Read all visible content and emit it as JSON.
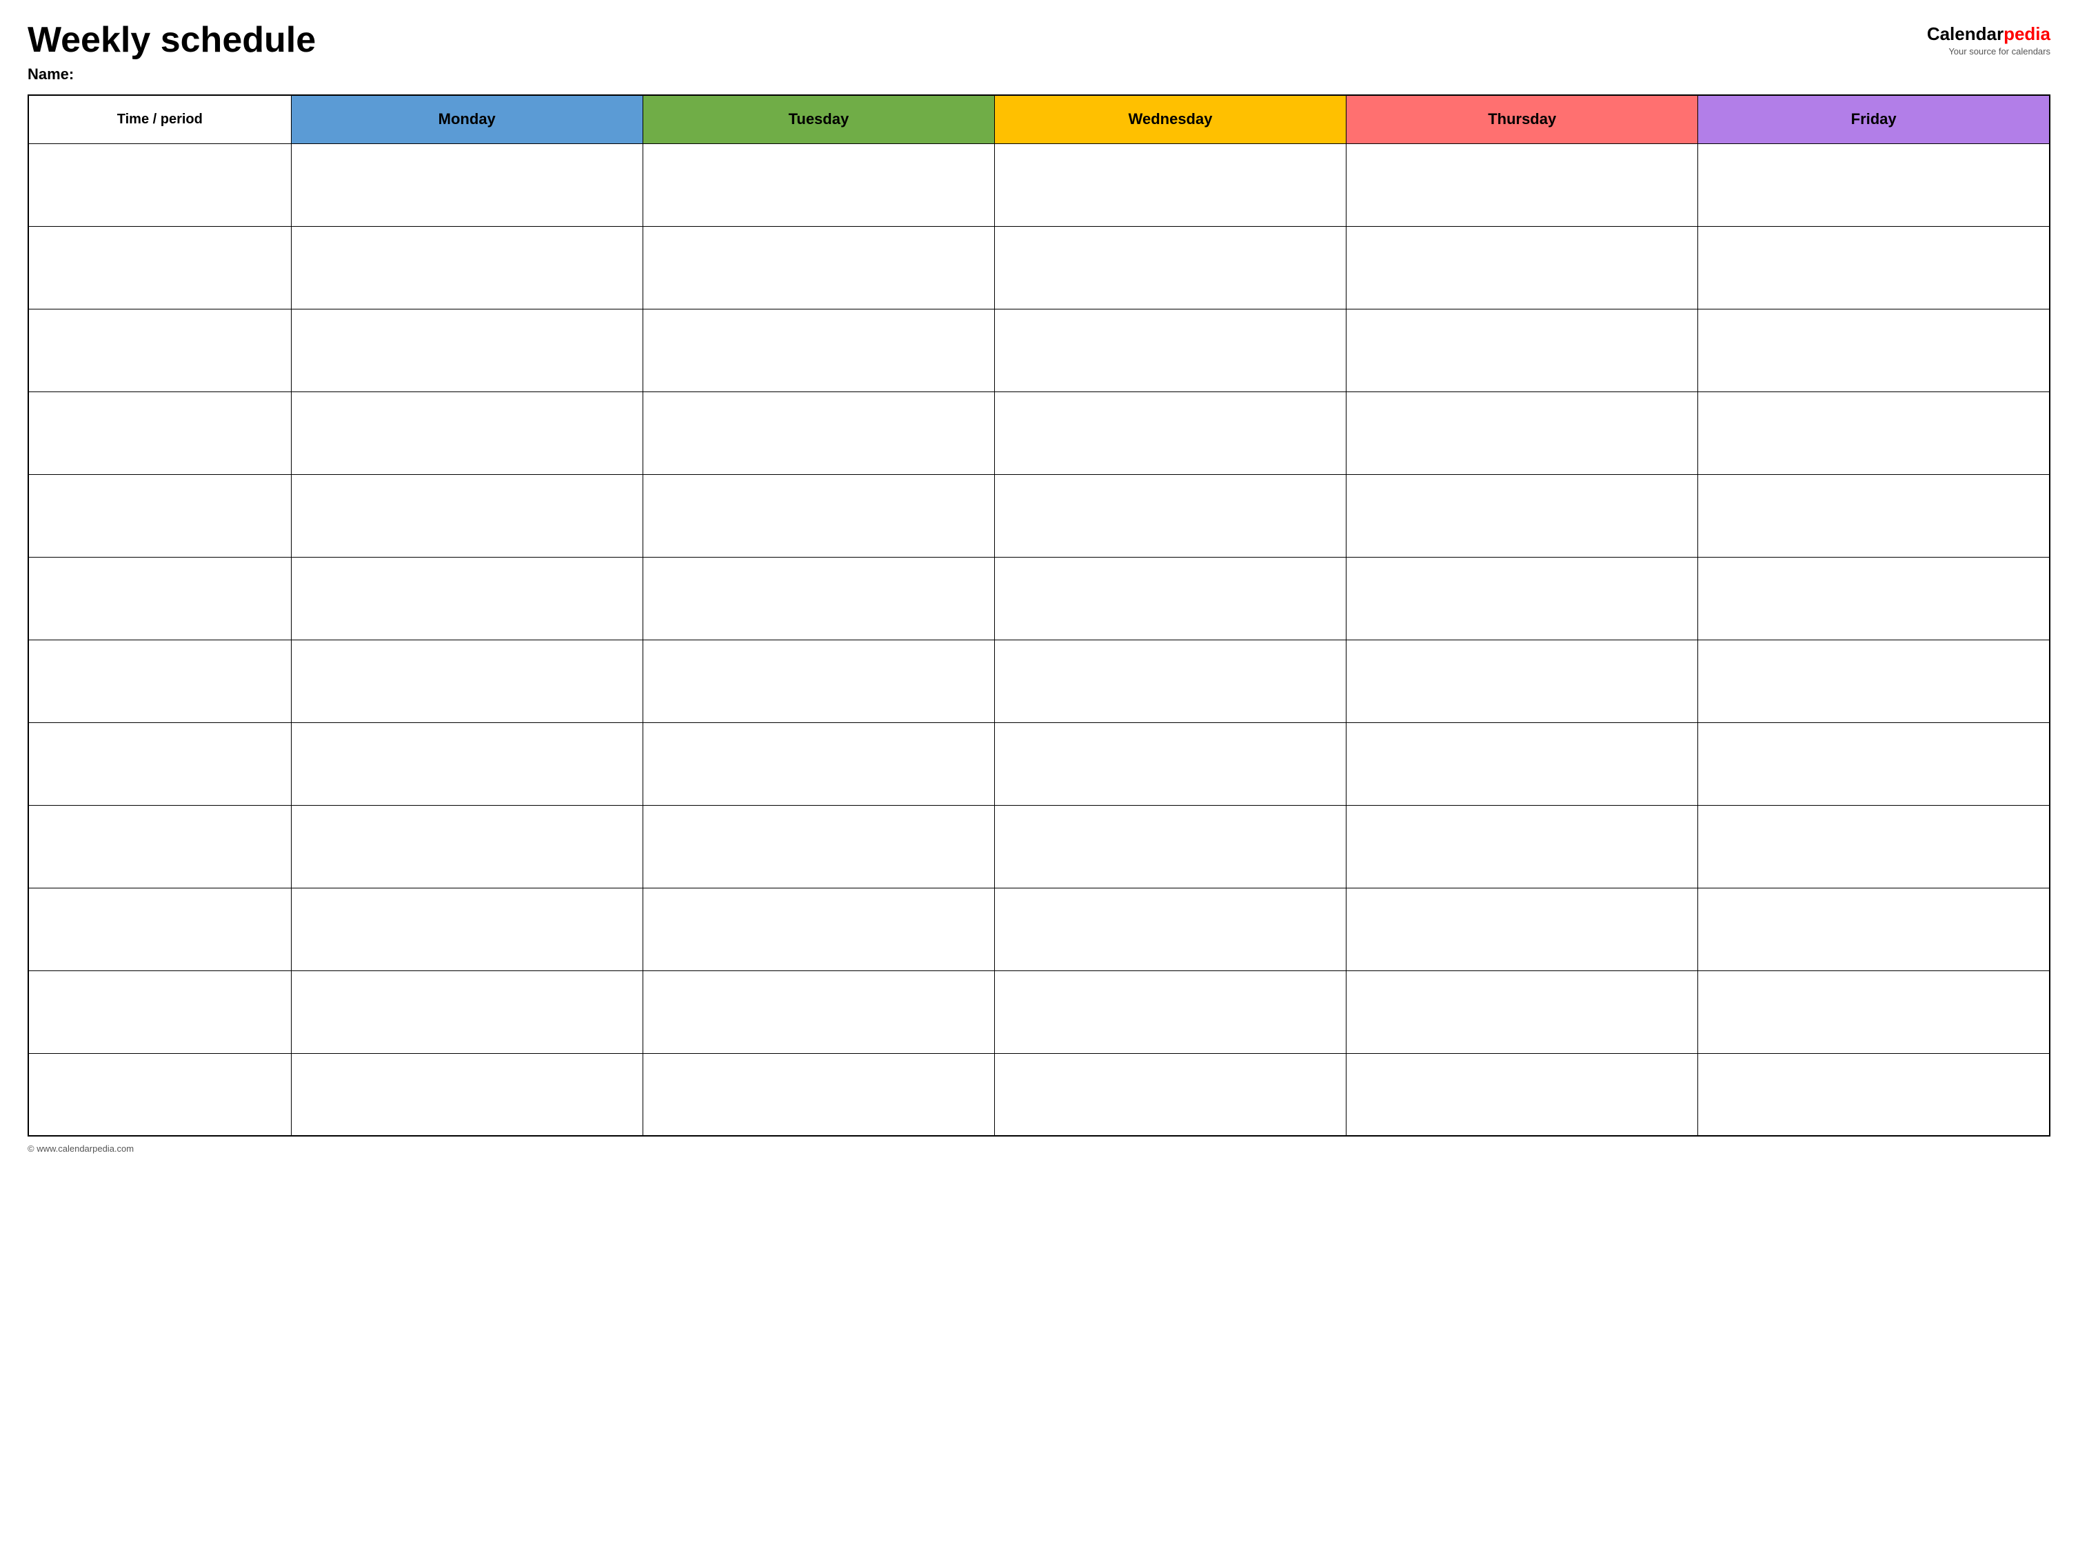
{
  "header": {
    "title": "Weekly schedule",
    "name_label": "Name:",
    "logo": {
      "calendar_part": "Calendar",
      "pedia_part": "pedia",
      "tagline": "Your source for calendars"
    }
  },
  "table": {
    "columns": [
      {
        "id": "time",
        "label": "Time / period",
        "color": "#ffffff",
        "class": "time-header"
      },
      {
        "id": "monday",
        "label": "Monday",
        "color": "#5b9bd5",
        "class": "monday-header"
      },
      {
        "id": "tuesday",
        "label": "Tuesday",
        "color": "#70ad47",
        "class": "tuesday-header"
      },
      {
        "id": "wednesday",
        "label": "Wednesday",
        "color": "#ffc000",
        "class": "wednesday-header"
      },
      {
        "id": "thursday",
        "label": "Thursday",
        "color": "#ff7070",
        "class": "thursday-header"
      },
      {
        "id": "friday",
        "label": "Friday",
        "color": "#b27ee8",
        "class": "friday-header"
      }
    ],
    "row_count": 12
  },
  "footer": {
    "text": "© www.calendarpedia.com"
  }
}
